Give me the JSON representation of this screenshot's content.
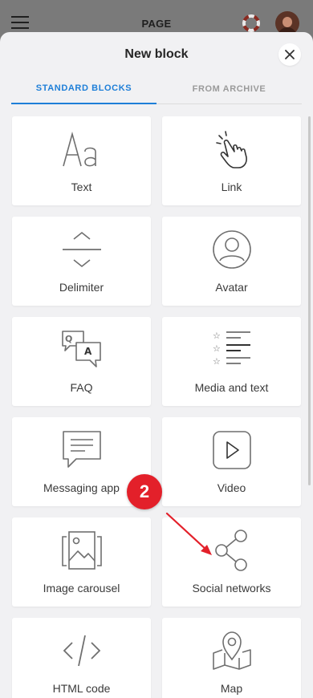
{
  "topbar": {
    "page_title": "PAGE",
    "menu_icon": "hamburger-menu-icon",
    "help_icon": "lifebuoy-icon",
    "avatar": "user-avatar"
  },
  "sheet": {
    "title": "New block",
    "close_icon": "close-icon",
    "tabs": [
      {
        "label": "STANDARD BLOCKS",
        "active": true
      },
      {
        "label": "FROM ARCHIVE",
        "active": false
      }
    ],
    "blocks": [
      {
        "label": "Text",
        "icon": "text-aa-icon"
      },
      {
        "label": "Link",
        "icon": "pointer-hand-icon"
      },
      {
        "label": "Delimiter",
        "icon": "delimiter-icon"
      },
      {
        "label": "Avatar",
        "icon": "avatar-icon"
      },
      {
        "label": "FAQ",
        "icon": "faq-qa-icon"
      },
      {
        "label": "Media and text",
        "icon": "media-text-list-icon"
      },
      {
        "label": "Messaging app",
        "icon": "chat-bubble-icon"
      },
      {
        "label": "Video",
        "icon": "play-video-icon"
      },
      {
        "label": "Image carousel",
        "icon": "image-carousel-icon"
      },
      {
        "label": "Social networks",
        "icon": "share-nodes-icon"
      },
      {
        "label": "HTML code",
        "icon": "code-brackets-icon"
      },
      {
        "label": "Map",
        "icon": "map-pin-icon"
      }
    ]
  },
  "annotation": {
    "step_number": "2",
    "color": "#e3202a"
  },
  "colors": {
    "accent": "#1e7fd8",
    "icon_gray": "#6f6f6f",
    "sheet_bg": "#f1f1f3"
  }
}
